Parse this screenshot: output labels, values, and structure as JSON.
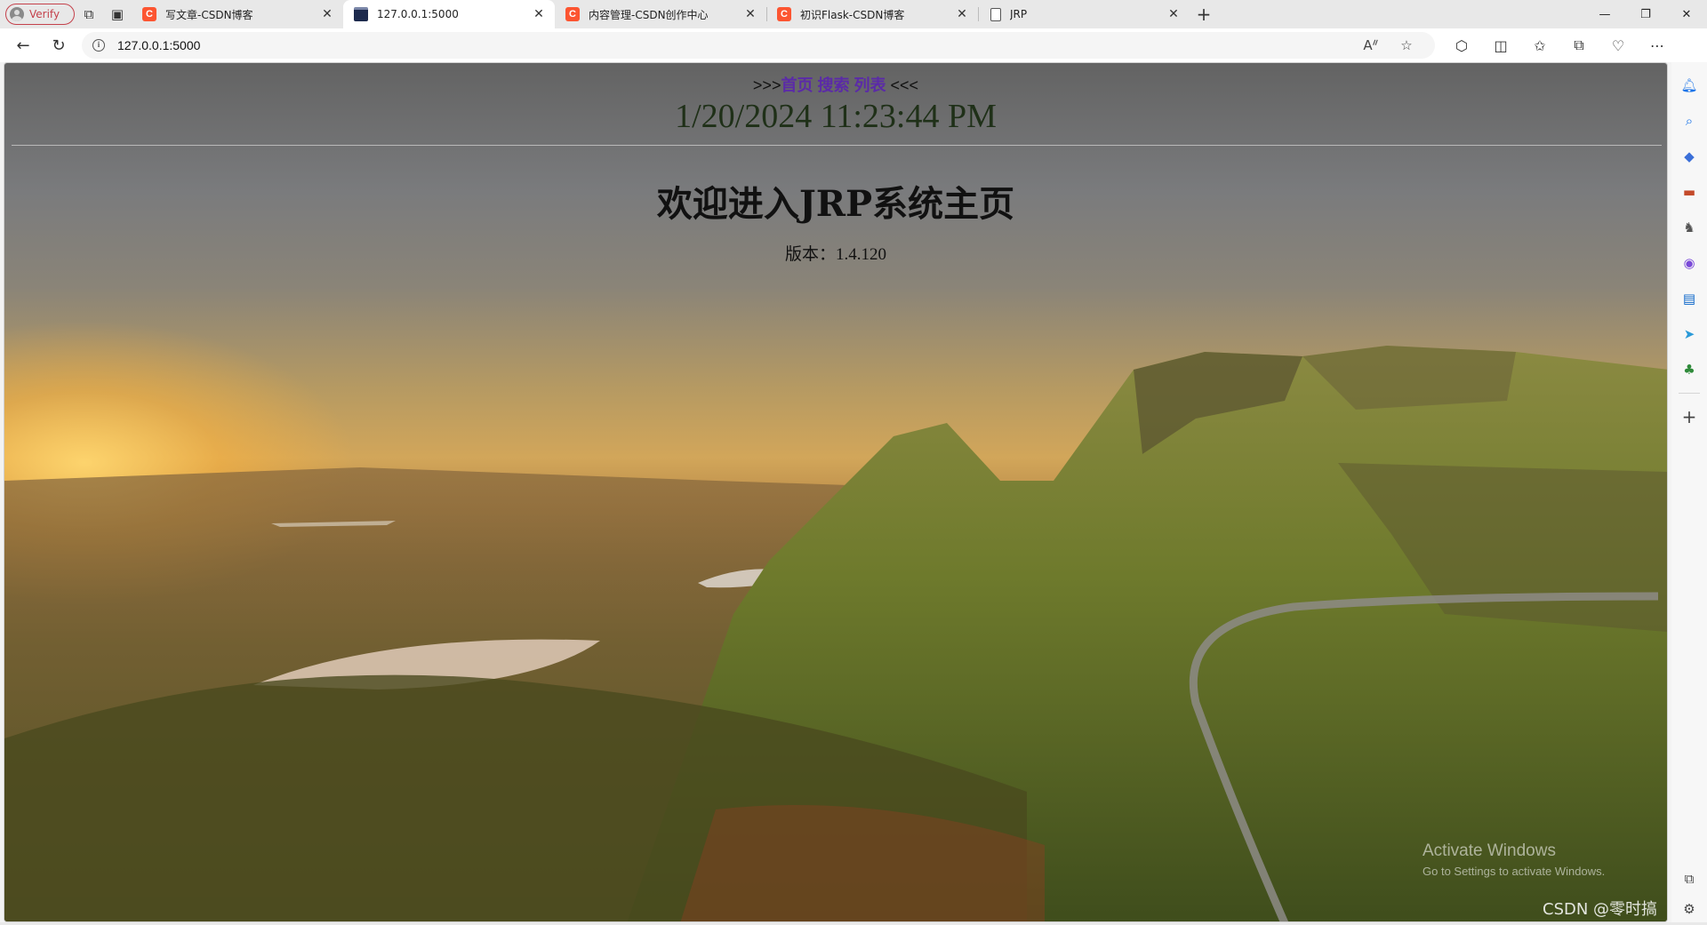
{
  "browser": {
    "profile_label": "Verify",
    "tabs": [
      {
        "title": "写文章-CSDN博客",
        "icon": "csdn-icon",
        "active": false
      },
      {
        "title": "127.0.0.1:5000",
        "icon": "terminal-icon",
        "active": true
      },
      {
        "title": "内容管理-CSDN创作中心",
        "icon": "csdn-icon",
        "active": false
      },
      {
        "title": "初识Flask-CSDN博客",
        "icon": "csdn-icon",
        "active": false
      },
      {
        "title": "JRP",
        "icon": "document-icon",
        "active": false
      }
    ],
    "address": "127.0.0.1:5000"
  },
  "page": {
    "nav_prefix": ">>>",
    "nav_links": [
      "首页",
      "搜索",
      "列表"
    ],
    "nav_suffix": "<<<",
    "clock": "1/20/2024 11:23:44 PM",
    "welcome": "欢迎进入JRP系统主页",
    "version": "版本：1.4.120"
  },
  "overlay": {
    "activate_title": "Activate Windows",
    "activate_sub": "Go to Settings to activate Windows.",
    "watermark": "CSDN @零时搞学习"
  }
}
